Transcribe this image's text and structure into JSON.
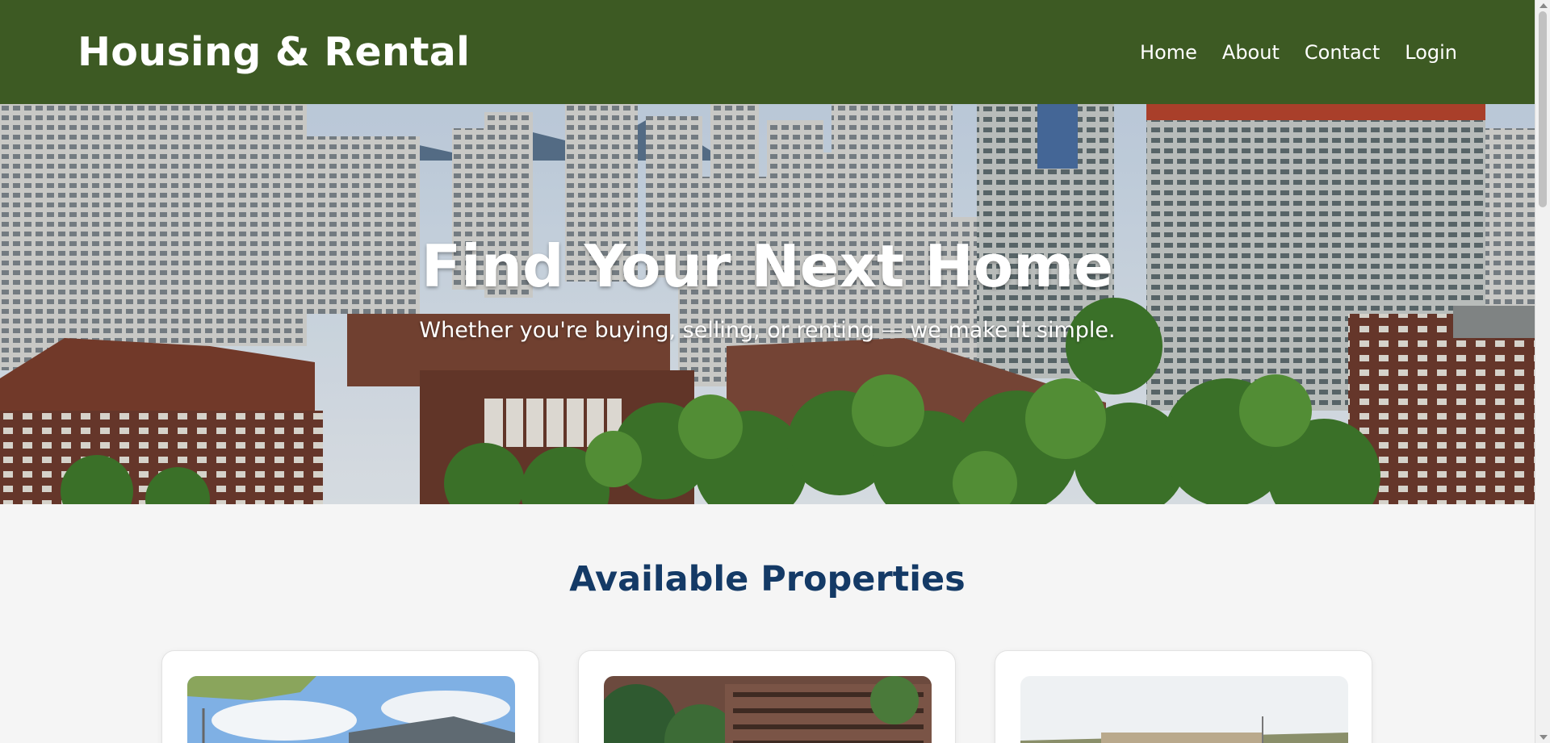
{
  "header": {
    "brand": "Housing & Rental",
    "nav": [
      "Home",
      "About",
      "Contact",
      "Login"
    ]
  },
  "hero": {
    "title": "Find Your Next Home",
    "subtitle": "Whether you're buying, selling, or renting — we make it simple."
  },
  "properties": {
    "title": "Available Properties"
  },
  "colors": {
    "header_bg": "#3d5a23",
    "section_title": "#143a66",
    "page_bg": "#f5f5f5"
  }
}
